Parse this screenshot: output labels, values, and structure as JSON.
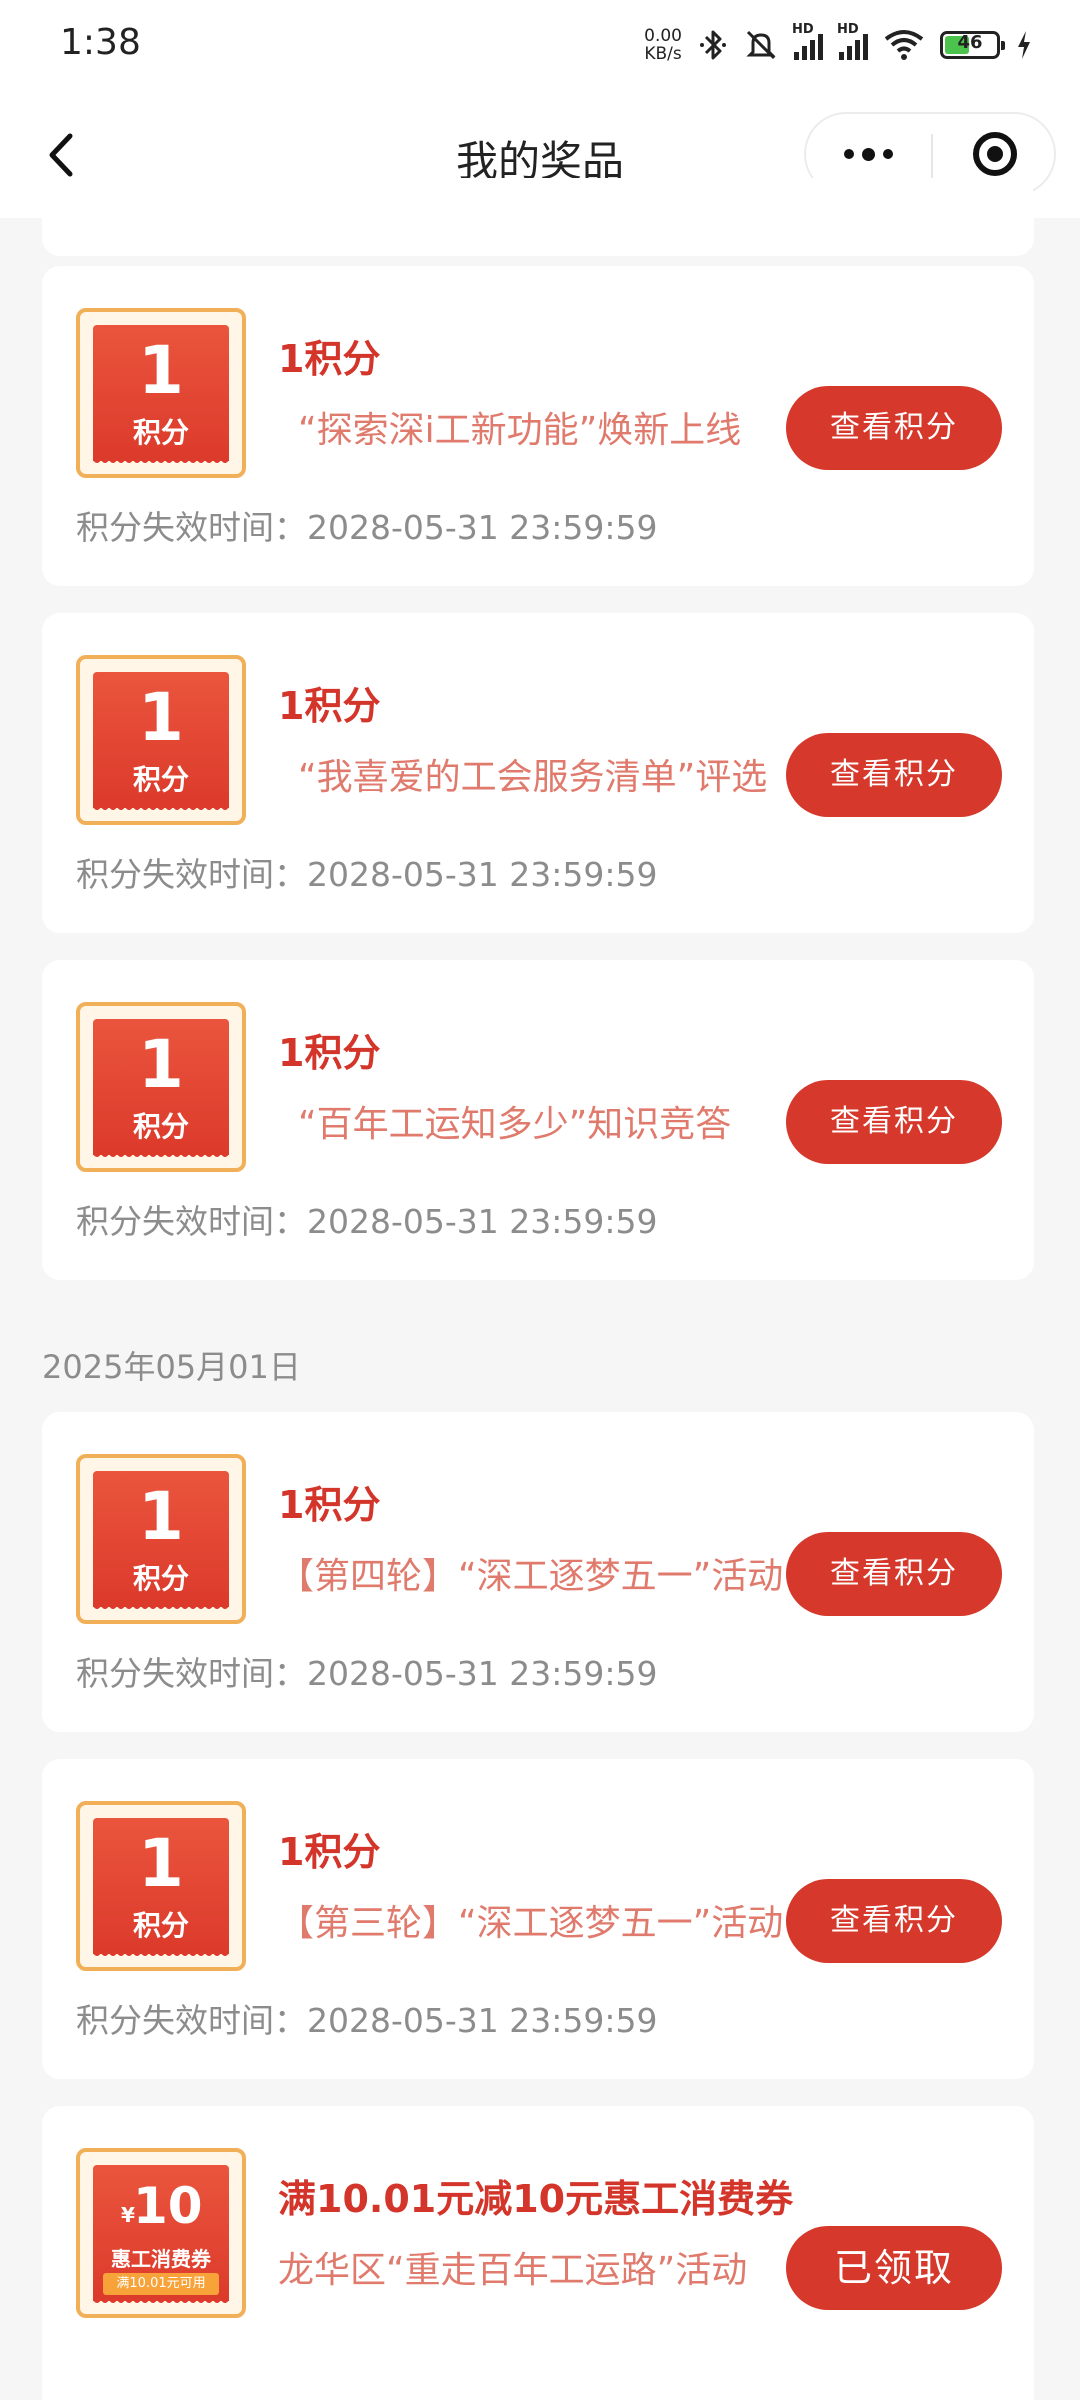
{
  "status_bar": {
    "time": "1:38",
    "net_speed_value": "0.00",
    "net_speed_unit": "KB/s",
    "hd1": "HD",
    "hd2": "HD",
    "battery": "46"
  },
  "nav": {
    "title": "我的奖品"
  },
  "sections": [
    {
      "date": "",
      "items": [
        {
          "badge_num": "1",
          "badge_unit": "积分",
          "title": "1积分",
          "desc": "“探索深i工新功能”焕新上线",
          "button": "查看积分",
          "expire": "积分失效时间：2028-05-31 23:59:59"
        },
        {
          "badge_num": "1",
          "badge_unit": "积分",
          "title": "1积分",
          "desc": "“我喜爱的工会服务清单”评选",
          "button": "查看积分",
          "expire": "积分失效时间：2028-05-31 23:59:59"
        },
        {
          "badge_num": "1",
          "badge_unit": "积分",
          "title": "1积分",
          "desc": "“百年工运知多少”知识竞答",
          "button": "查看积分",
          "expire": "积分失效时间：2028-05-31 23:59:59"
        }
      ]
    },
    {
      "date": "2025年05月01日",
      "items": [
        {
          "badge_num": "1",
          "badge_unit": "积分",
          "title": "1积分",
          "desc": "【第四轮】“深工逐梦五一”活动",
          "button": "查看积分",
          "expire": "积分失效时间：2028-05-31 23:59:59"
        },
        {
          "badge_num": "1",
          "badge_unit": "积分",
          "title": "1积分",
          "desc": "【第三轮】“深工逐梦五一”活动",
          "button": "查看积分",
          "expire": "积分失效时间：2028-05-31 23:59:59"
        },
        {
          "coupon_currency": "¥",
          "coupon_amount": "10",
          "coupon_name": "惠工消费券",
          "coupon_condition": "满10.01元可用",
          "title": "满10.01元减10元惠工消费券",
          "desc": "龙华区“重走百年工运路”活动",
          "button": "已领取"
        }
      ]
    }
  ],
  "colors": {
    "accent": "#d6382b",
    "title_red": "#d4352a",
    "desc_red": "#e07a6c",
    "badge_border": "#f1b057"
  }
}
